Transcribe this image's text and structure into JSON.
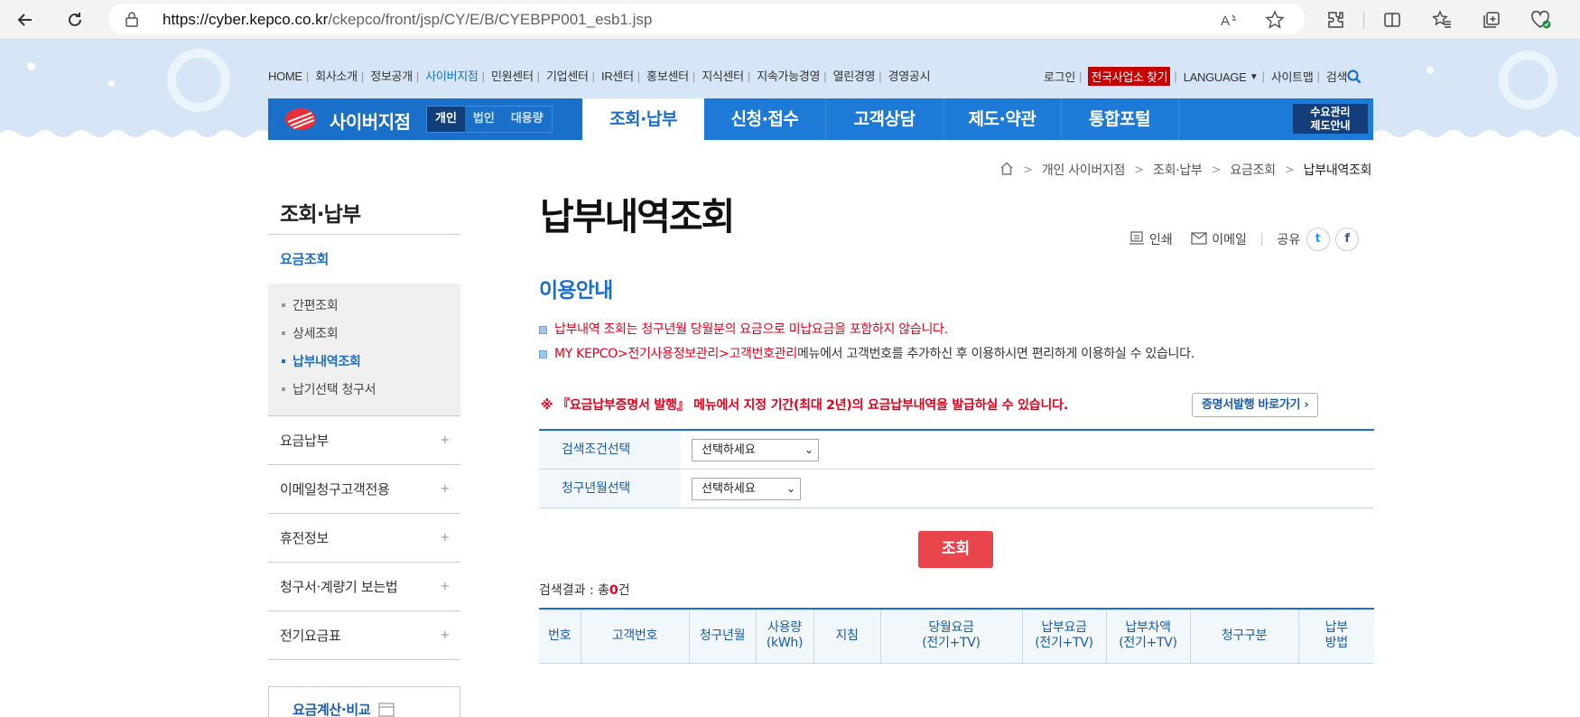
{
  "browser": {
    "url_host": "https://cyber.kepco.co.kr",
    "url_path": "/ckepco/front/jsp/CY/E/B/CYEBPP001_esb1.jsp"
  },
  "header": {
    "util_links": [
      "HOME",
      "회사소개",
      "정보공개",
      "사이버지점",
      "민원센터",
      "기업센터",
      "IR센터",
      "홍보센터",
      "지식센터",
      "지속가능경영",
      "열린경영",
      "경영공시"
    ],
    "util_active": "사이버지점",
    "login": "로그인",
    "find_office": "전국사업소 찾기",
    "language": "LANGUAGE",
    "sitemap": "사이트맵",
    "search": "검색",
    "brand": "사이버지점",
    "segments": [
      "개인",
      "법인",
      "대용량"
    ],
    "segment_active": "개인",
    "menu": [
      "조회·납부",
      "신청·접수",
      "고객상담",
      "제도·약관",
      "통합포털"
    ],
    "extra_line1": "수요관리",
    "extra_line2": "제도안내"
  },
  "breadcrumb": [
    "개인 사이버지점",
    "조회·납부",
    "요금조회",
    "납부내역조회"
  ],
  "sidebar": {
    "title": "조회·납부",
    "active": "요금조회",
    "subitems": [
      "간편조회",
      "상세조회",
      "납부내역조회",
      "납기선택 청구서"
    ],
    "subitem_active": "납부내역조회",
    "items": [
      "요금납부",
      "이메일청구고객전용",
      "휴전정보",
      "청구서·계량기 보는법",
      "전기요금표"
    ],
    "calc_box": "요금계산·비교"
  },
  "content": {
    "title": "납부내역조회",
    "share": {
      "print": "인쇄",
      "email": "이메일",
      "share": "공유",
      "twitter": "t",
      "facebook": "f"
    },
    "section_title": "이용안내",
    "guide1": "납부내역 조회는 청구년월 당월분의 요금으로 미납요금을 포함하지 않습니다.",
    "guide2_red": "MY KEPCO>전기사용정보관리>고객번호관리",
    "guide2_rest": "메뉴에서 고객번호를 추가하신 후 이용하시면 편리하게 이용하실 수 있습니다.",
    "notice": "※ 『요금납부증명서 발행』 메뉴에서 지정 기간(최대 2년)의 요금납부내역을 발급하실 수 있습니다.",
    "notice_button": "증명서발행 바로가기 ›",
    "form": {
      "condition_label": "검색조건선택",
      "condition_value": "선택하세요",
      "month_label": "청구년월선택",
      "month_value": "선택하세요"
    },
    "search_button": "조회",
    "result_prefix": "검색결과 : 총",
    "result_count": "0",
    "result_suffix": "건",
    "table_headers": [
      [
        "번호"
      ],
      [
        "고객번호"
      ],
      [
        "청구년월"
      ],
      [
        "사용량",
        "(kWh)"
      ],
      [
        "지침"
      ],
      [
        "당월요금",
        "(전기+TV)"
      ],
      [
        "납부요금",
        "(전기+TV)"
      ],
      [
        "납부차액",
        "(전기+TV)"
      ],
      [
        "청구구분"
      ],
      [
        "납부",
        "방법"
      ]
    ]
  }
}
